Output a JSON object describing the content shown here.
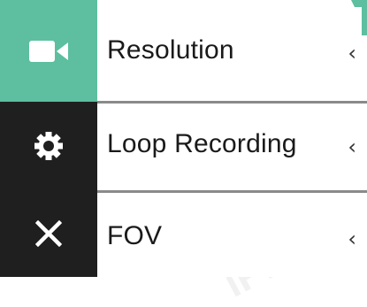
{
  "menu": {
    "items": [
      {
        "label": "Resolution",
        "icon": "video-camera-icon",
        "chevron": "‹",
        "active": true
      },
      {
        "label": "Loop Recording",
        "icon": "gear-icon",
        "chevron": "‹",
        "active": false
      },
      {
        "label": "FOV",
        "icon": "close-icon",
        "chevron": "‹",
        "active": false
      }
    ]
  },
  "colors": {
    "accent": "#5dbf9f",
    "sidebar": "#1f1f1f",
    "divider": "#8a8a8a"
  }
}
